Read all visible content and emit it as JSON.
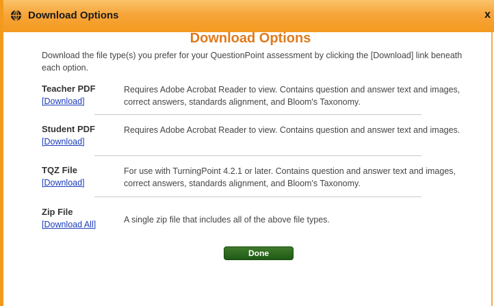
{
  "window": {
    "title": "Download Options",
    "close_label": "x",
    "icon": "globe-icon"
  },
  "main": {
    "heading": "Download Options",
    "intro": "Download the file type(s) you prefer for your QuestionPoint assessment by clicking the [Download] link beneath each option.",
    "options": [
      {
        "name": "Teacher PDF",
        "link": "[Download]",
        "description": "Requires Adobe Acrobat Reader to view. Contains question and answer text and images, correct answers, standards alignment, and Bloom's Taxonomy."
      },
      {
        "name": "Student PDF",
        "link": "[Download]",
        "description": "Requires Adobe Acrobat Reader to view. Contains question and answer text and images."
      },
      {
        "name": "TQZ File",
        "link": "[Download]",
        "description": "For use with TurningPoint 4.2.1 or later. Contains question and answer text and images, correct answers, standards alignment, and Bloom's Taxonomy."
      },
      {
        "name": "Zip File",
        "link": "[Download All]",
        "description": "A single zip file that includes all of the above file types."
      }
    ],
    "done_label": "Done"
  },
  "colors": {
    "title_bar": "#f7a53a",
    "heading": "#e07a1b",
    "link": "#1a3cb8",
    "done_button": "#2a6a1c"
  }
}
